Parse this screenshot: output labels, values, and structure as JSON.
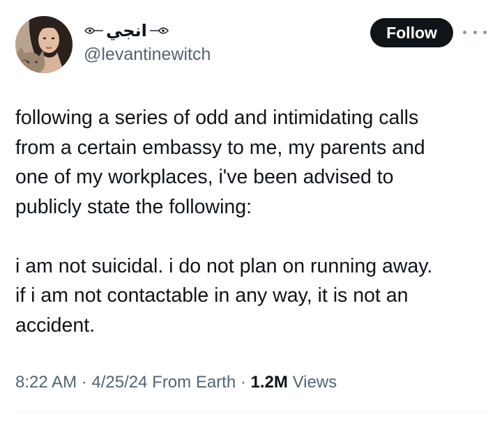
{
  "user": {
    "display_name": "انجي",
    "handle": "@levantinewitch",
    "avatar_icon": "profile-photo-with-cat"
  },
  "actions": {
    "follow_label": "Follow",
    "more_icon": "more-horizontal-icon"
  },
  "tweet": {
    "paragraphs": [
      "following a series of odd and intimidating calls\nfrom a certain embassy to me, my parents and\none of my workplaces, i've been advised to\npublicly state the following:",
      "i am not suicidal. i do not plan on running away.\nif i am not contactable in any way, it is not an\naccident."
    ]
  },
  "meta": {
    "time": "8:22 AM",
    "date": "4/25/24",
    "source": "From Earth",
    "views_count": "1.2M",
    "views_label": "Views",
    "separator": "·"
  },
  "colors": {
    "text_primary": "#0f1419",
    "text_secondary": "#536471",
    "follow_bg": "#0f1419",
    "follow_text": "#ffffff"
  }
}
